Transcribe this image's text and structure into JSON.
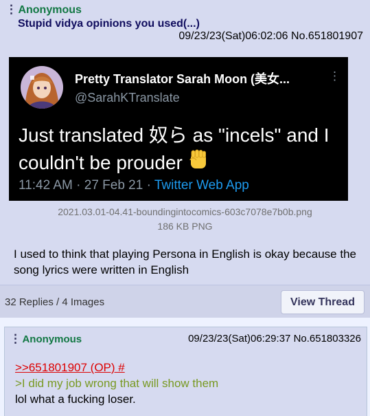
{
  "op": {
    "name": "Anonymous",
    "subject": "Stupid vidya opinions you used(...)",
    "datetime": "09/23/23(Sat)06:02:06",
    "post_no": "No.651801907",
    "tweet": {
      "display_name": "Pretty Translator Sarah Moon (美女...",
      "handle": "@SarahKTranslate",
      "text": "Just translated 奴ら as \"incels\" and I couldn't be prouder",
      "emoji": "raised-fist-emoji",
      "time_date": "11:42 AM · 27 Feb 21 · ",
      "app": "Twitter Web App"
    },
    "file_name": "2021.03.01-04.41-boundingintocomics-603c7078e7b0b.png",
    "file_meta": "186 KB PNG",
    "comment": "I used to think that playing Persona in English is okay because the song lyrics were written in English",
    "replies_summary": "32 Replies / 4 Images",
    "view_thread_label": "View Thread"
  },
  "reply": {
    "name": "Anonymous",
    "datetime": "09/23/23(Sat)06:29:37",
    "post_no": "No.651803326",
    "quote_link": ">>651801907 (OP) #",
    "greentext": ">I did my job wrong that will show them",
    "text": "lol what a fucking loser."
  },
  "colors": {
    "name_green": "#117743",
    "subject_blue": "#0f0c5d",
    "post_bg": "#d6daf0",
    "page_bg": "#eef2ff",
    "quote_red": "#dd0000",
    "greentext": "#789922",
    "twitter_blue": "#1d9bf0"
  }
}
